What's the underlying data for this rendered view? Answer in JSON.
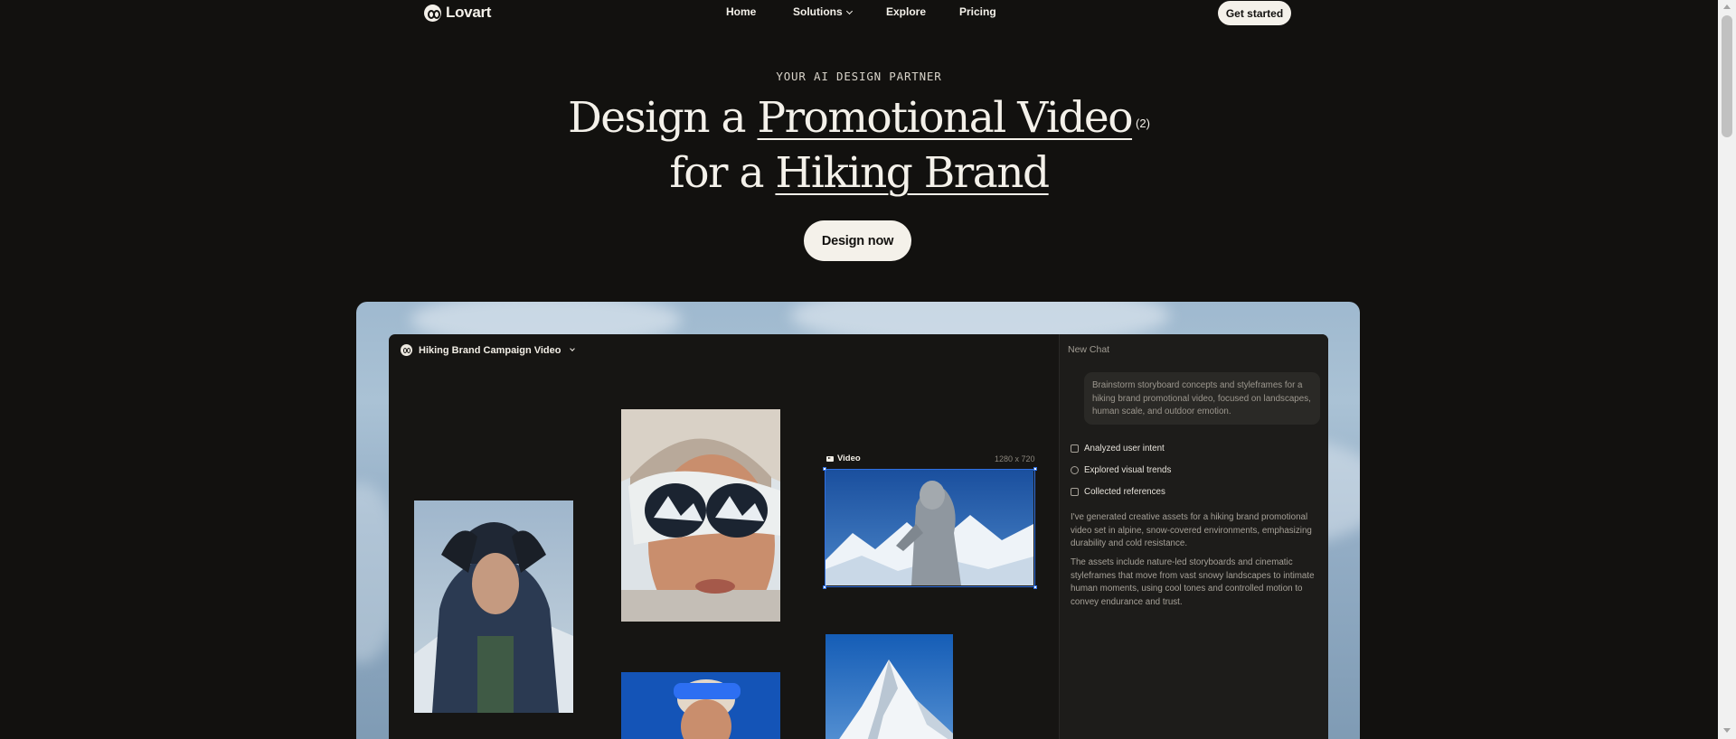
{
  "nav": {
    "logo_text": "Lovart",
    "links": [
      "Home",
      "Solutions",
      "Explore",
      "Pricing"
    ],
    "cta": "Get started"
  },
  "hero": {
    "eyebrow": "YOUR AI DESIGN PARTNER",
    "line1_pre": "Design a ",
    "line1_highlight": "Promotional Video",
    "footnote": "(2)",
    "line2_pre": "for a ",
    "line2_highlight": "Hiking Brand",
    "cta": "Design now"
  },
  "app": {
    "project_title": "Hiking Brand Campaign Video",
    "video_label": "Video",
    "video_size": "1280 x 720",
    "chat": {
      "header": "New Chat",
      "prompt": "Brainstorm storyboard concepts and styleframes for a hiking brand promotional video, focused on landscapes, human scale, and outdoor emotion.",
      "steps": [
        "Analyzed user intent",
        "Explored visual trends",
        "Collected references"
      ],
      "paragraphs": [
        "I've generated creative assets for a hiking brand promotional video set in alpine, snow-covered environments, emphasizing durability and cold resistance.",
        "The assets include nature-led storyboards and cinematic styleframes that move from vast snowy landscapes to intimate human moments, using cool tones and controlled motion to convey endurance and trust."
      ]
    }
  },
  "colors": {
    "background": "#12110f",
    "cream": "#f4f1ea",
    "selection": "#2f6fe0"
  }
}
